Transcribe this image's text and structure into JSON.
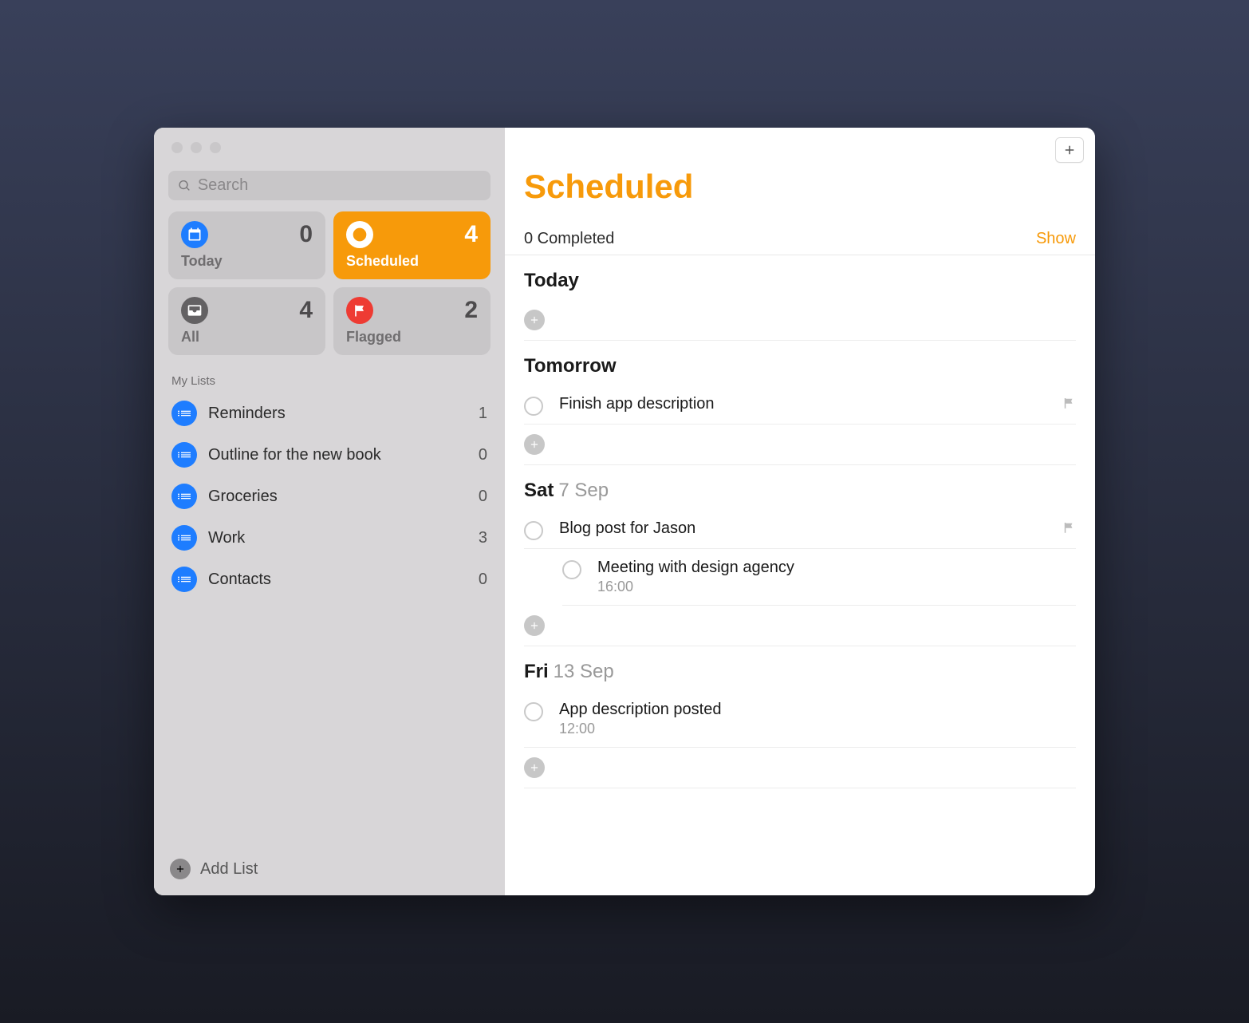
{
  "search": {
    "placeholder": "Search"
  },
  "smart": {
    "today": {
      "label": "Today",
      "count": "0"
    },
    "scheduled": {
      "label": "Scheduled",
      "count": "4"
    },
    "all": {
      "label": "All",
      "count": "4"
    },
    "flagged": {
      "label": "Flagged",
      "count": "2"
    }
  },
  "lists_header": "My Lists",
  "lists": [
    {
      "name": "Reminders",
      "count": "1"
    },
    {
      "name": "Outline for the new book",
      "count": "0"
    },
    {
      "name": "Groceries",
      "count": "0"
    },
    {
      "name": "Work",
      "count": "3"
    },
    {
      "name": "Contacts",
      "count": "0"
    }
  ],
  "add_list": "Add List",
  "main": {
    "title": "Scheduled",
    "completed": "0 Completed",
    "show": "Show",
    "sections": [
      {
        "head_strong": "Today",
        "head_rest": "",
        "tasks": []
      },
      {
        "head_strong": "Tomorrow",
        "head_rest": "",
        "tasks": [
          {
            "title": "Finish app description",
            "time": "",
            "flagged": true
          }
        ]
      },
      {
        "head_strong": "Sat",
        "head_rest": "7 Sep",
        "tasks": [
          {
            "title": "Blog post for Jason",
            "time": "",
            "flagged": true
          },
          {
            "title": "Meeting with design agency",
            "time": "16:00",
            "flagged": false
          }
        ]
      },
      {
        "head_strong": "Fri",
        "head_rest": "13 Sep",
        "tasks": [
          {
            "title": "App description posted",
            "time": "12:00",
            "flagged": false
          }
        ]
      }
    ]
  }
}
